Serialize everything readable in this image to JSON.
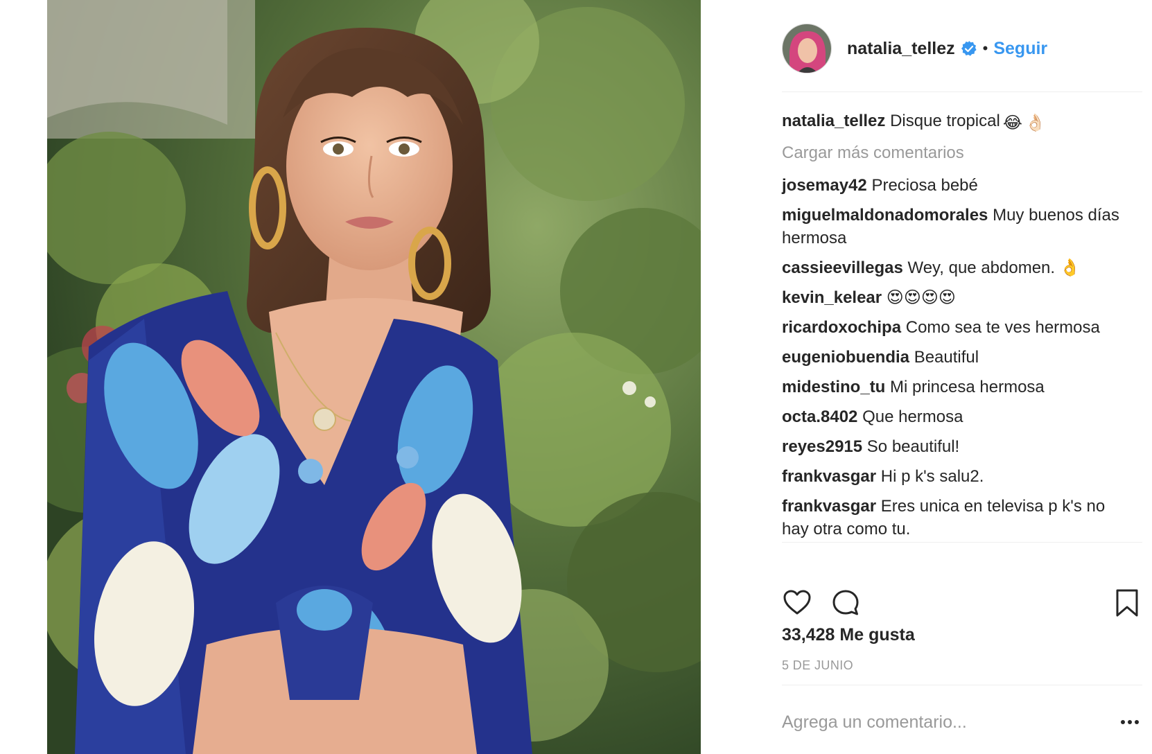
{
  "photo": {
    "icon": "post-photo"
  },
  "header": {
    "username": "natalia_tellez",
    "separator": "•",
    "follow_label": "Seguir",
    "verified_icon": "verified-badge-icon",
    "accent_color": "#3897f0"
  },
  "caption": {
    "username": "natalia_tellez",
    "text": "Disque tropical",
    "emoji": [
      "😂",
      "👌🏻"
    ]
  },
  "load_more_label": "Cargar más comentarios",
  "comments": [
    {
      "username": "josemay42",
      "text": "Preciosa bebé"
    },
    {
      "username": "miguelmaldonadomorales",
      "text": "Muy buenos días hermosa"
    },
    {
      "username": "cassieevillegas",
      "text": "Wey, que abdomen. 👌"
    },
    {
      "username": "kevin_kelear",
      "text": "😍😍😍😍"
    },
    {
      "username": "ricardoxochipa",
      "text": "Como sea te ves hermosa"
    },
    {
      "username": "eugeniobuendia",
      "text": "Beautiful"
    },
    {
      "username": "midestino_tu",
      "text": "Mi princesa hermosa"
    },
    {
      "username": "octa.8402",
      "text": "Que hermosa"
    },
    {
      "username": "reyes2915",
      "text": "So beautiful!"
    },
    {
      "username": "frankvasgar",
      "text": "Hi p k's salu2."
    },
    {
      "username": "frankvasgar",
      "text": "Eres unica en televisa p k's no hay otra como tu."
    }
  ],
  "actions": {
    "like_icon": "heart-icon",
    "comment_icon": "comment-bubble-icon",
    "save_icon": "bookmark-icon"
  },
  "likes_label": "33,428 Me gusta",
  "date_label": "5 DE JUNIO",
  "add_comment": {
    "placeholder": "Agrega un comentario...",
    "more_icon": "more-options-icon"
  }
}
